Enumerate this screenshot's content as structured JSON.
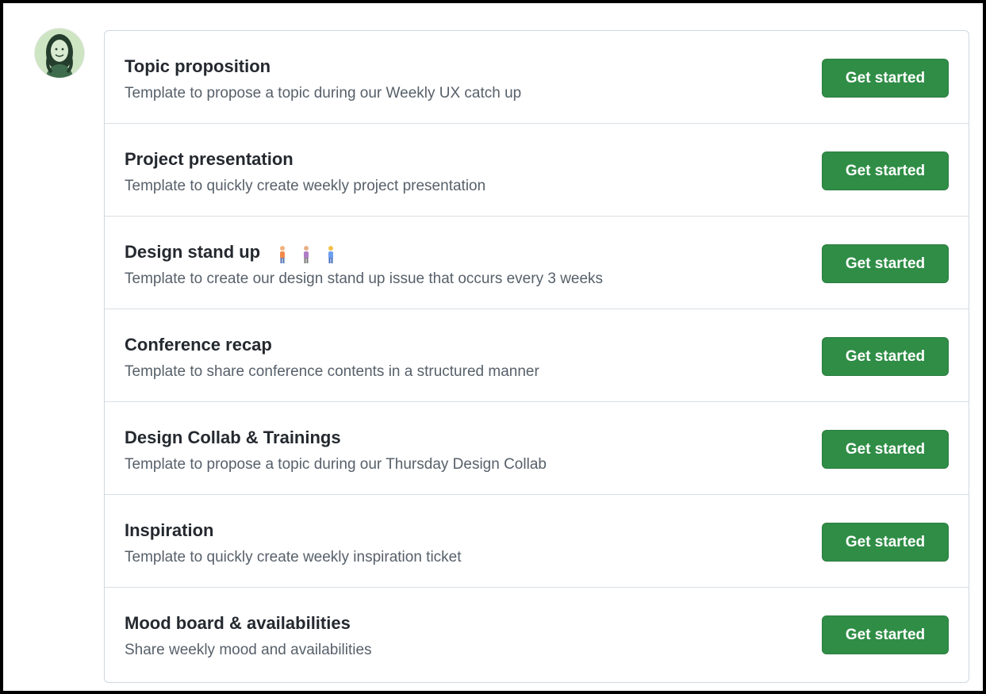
{
  "templates": [
    {
      "title": "Topic proposition",
      "description": "Template to propose a topic during our Weekly UX catch up",
      "button_label": "Get started"
    },
    {
      "title": "Project presentation",
      "description": "Template to quickly create weekly project presentation",
      "button_label": "Get started"
    },
    {
      "title": "Design stand up",
      "title_icons": [
        "person-standing-icon",
        "person-standing-icon",
        "person-standing-icon"
      ],
      "description": "Template to create our design stand up issue that occurs every 3 weeks",
      "button_label": "Get started"
    },
    {
      "title": "Conference recap",
      "description": "Template to share conference contents in a structured manner",
      "button_label": "Get started"
    },
    {
      "title": "Design Collab & Trainings",
      "description": "Template to propose a topic during our Thursday Design Collab",
      "button_label": "Get started"
    },
    {
      "title": "Inspiration",
      "description": "Template to quickly create weekly inspiration ticket",
      "button_label": "Get started"
    },
    {
      "title": "Mood board & availabilities",
      "description": "Share weekly mood and availabilities",
      "button_label": "Get started"
    }
  ],
  "colors": {
    "button_green": "#2f8d46",
    "title_text": "#24292f",
    "description_text": "#57606a",
    "border": "#d0d7de"
  },
  "icons": {
    "avatar": "user-avatar",
    "person_emoji_colors": [
      "#f08a4b",
      "#b07cc6",
      "#6d9ef0"
    ]
  }
}
